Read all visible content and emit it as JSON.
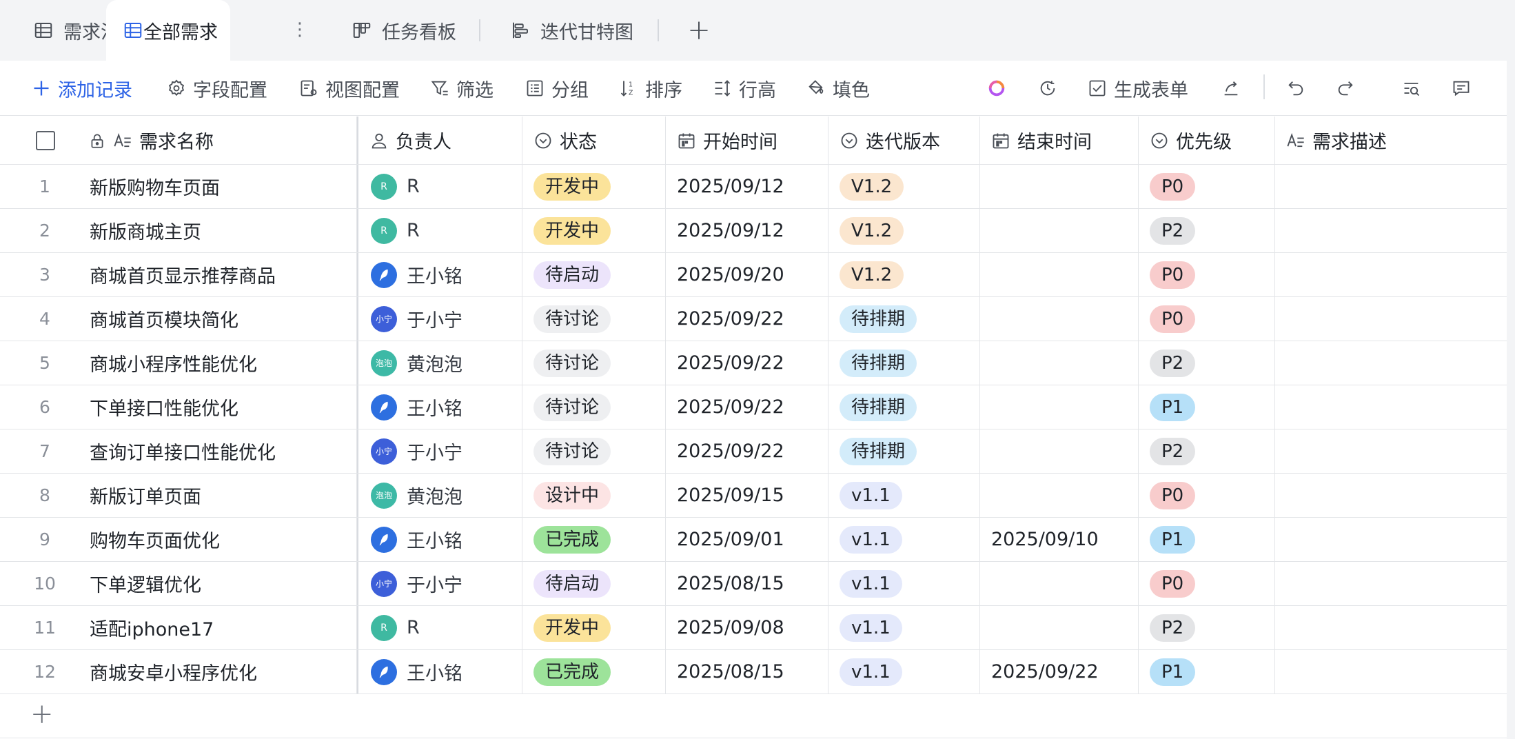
{
  "tabs": [
    {
      "label": "需求池",
      "icon": "table-icon"
    },
    {
      "label": "全部需求",
      "icon": "table-icon",
      "active": true
    },
    {
      "label": "任务看板",
      "icon": "kanban-icon"
    },
    {
      "label": "迭代甘特图",
      "icon": "gantt-icon"
    }
  ],
  "tab_more": "⋮",
  "tab_add": "+",
  "toolbar": {
    "add_record": "添加记录",
    "field_config": "字段配置",
    "view_config": "视图配置",
    "filter": "筛选",
    "group": "分组",
    "sort": "排序",
    "row_height": "行高",
    "fill_color": "填色",
    "generate_form": "生成表单"
  },
  "columns": {
    "name": "需求名称",
    "owner": "负责人",
    "status": "状态",
    "start": "开始时间",
    "version": "迭代版本",
    "end": "结束时间",
    "priority": "优先级",
    "desc": "需求描述"
  },
  "colors": {
    "accent": "#2d63e6",
    "status": {
      "开发中": "#fbe39a",
      "待启动": "#ece4fb",
      "待讨论": "#eeeff1",
      "设计中": "#fce4e4",
      "已完成": "#9de39a"
    },
    "version": {
      "V1.2": "#fbe6cf",
      "待排期": "#d3ecfa",
      "v1.1": "#e4e9fb"
    },
    "priority": {
      "P0": "#f8cccc",
      "P1": "#b6e0f8",
      "P2": "#e3e4e6"
    },
    "avatar": {
      "R": "#3fb9a1",
      "王小铭": "#2d6fe0",
      "于小宁": "#3d5fd9",
      "黄泡泡": "#3db9a6"
    }
  },
  "avatars": {
    "R": "R",
    "王小铭": "",
    "于小宁": "小宁",
    "黄泡泡": "泡泡"
  },
  "rows": [
    {
      "num": "1",
      "name": "新版购物车页面",
      "owner": "R",
      "status": "开发中",
      "start": "2025/09/12",
      "version": "V1.2",
      "end": "",
      "priority": "P0",
      "desc": ""
    },
    {
      "num": "2",
      "name": "新版商城主页",
      "owner": "R",
      "status": "开发中",
      "start": "2025/09/12",
      "version": "V1.2",
      "end": "",
      "priority": "P2",
      "desc": ""
    },
    {
      "num": "3",
      "name": "商城首页显示推荐商品",
      "owner": "王小铭",
      "status": "待启动",
      "start": "2025/09/20",
      "version": "V1.2",
      "end": "",
      "priority": "P0",
      "desc": ""
    },
    {
      "num": "4",
      "name": "商城首页模块简化",
      "owner": "于小宁",
      "status": "待讨论",
      "start": "2025/09/22",
      "version": "待排期",
      "end": "",
      "priority": "P0",
      "desc": ""
    },
    {
      "num": "5",
      "name": "商城小程序性能优化",
      "owner": "黄泡泡",
      "status": "待讨论",
      "start": "2025/09/22",
      "version": "待排期",
      "end": "",
      "priority": "P2",
      "desc": ""
    },
    {
      "num": "6",
      "name": "下单接口性能优化",
      "owner": "王小铭",
      "status": "待讨论",
      "start": "2025/09/22",
      "version": "待排期",
      "end": "",
      "priority": "P1",
      "desc": ""
    },
    {
      "num": "7",
      "name": "查询订单接口性能优化",
      "owner": "于小宁",
      "status": "待讨论",
      "start": "2025/09/22",
      "version": "待排期",
      "end": "",
      "priority": "P2",
      "desc": ""
    },
    {
      "num": "8",
      "name": "新版订单页面",
      "owner": "黄泡泡",
      "status": "设计中",
      "start": "2025/09/15",
      "version": "v1.1",
      "end": "",
      "priority": "P0",
      "desc": ""
    },
    {
      "num": "9",
      "name": "购物车页面优化",
      "owner": "王小铭",
      "status": "已完成",
      "start": "2025/09/01",
      "version": "v1.1",
      "end": "2025/09/10",
      "priority": "P1",
      "desc": ""
    },
    {
      "num": "10",
      "name": "下单逻辑优化",
      "owner": "于小宁",
      "status": "待启动",
      "start": "2025/08/15",
      "version": "v1.1",
      "end": "",
      "priority": "P0",
      "desc": ""
    },
    {
      "num": "11",
      "name": "适配iphone17",
      "owner": "R",
      "status": "开发中",
      "start": "2025/09/08",
      "version": "v1.1",
      "end": "",
      "priority": "P2",
      "desc": ""
    },
    {
      "num": "12",
      "name": "商城安卓小程序优化",
      "owner": "王小铭",
      "status": "已完成",
      "start": "2025/08/15",
      "version": "v1.1",
      "end": "2025/09/22",
      "priority": "P1",
      "desc": ""
    }
  ],
  "add_row": "+"
}
